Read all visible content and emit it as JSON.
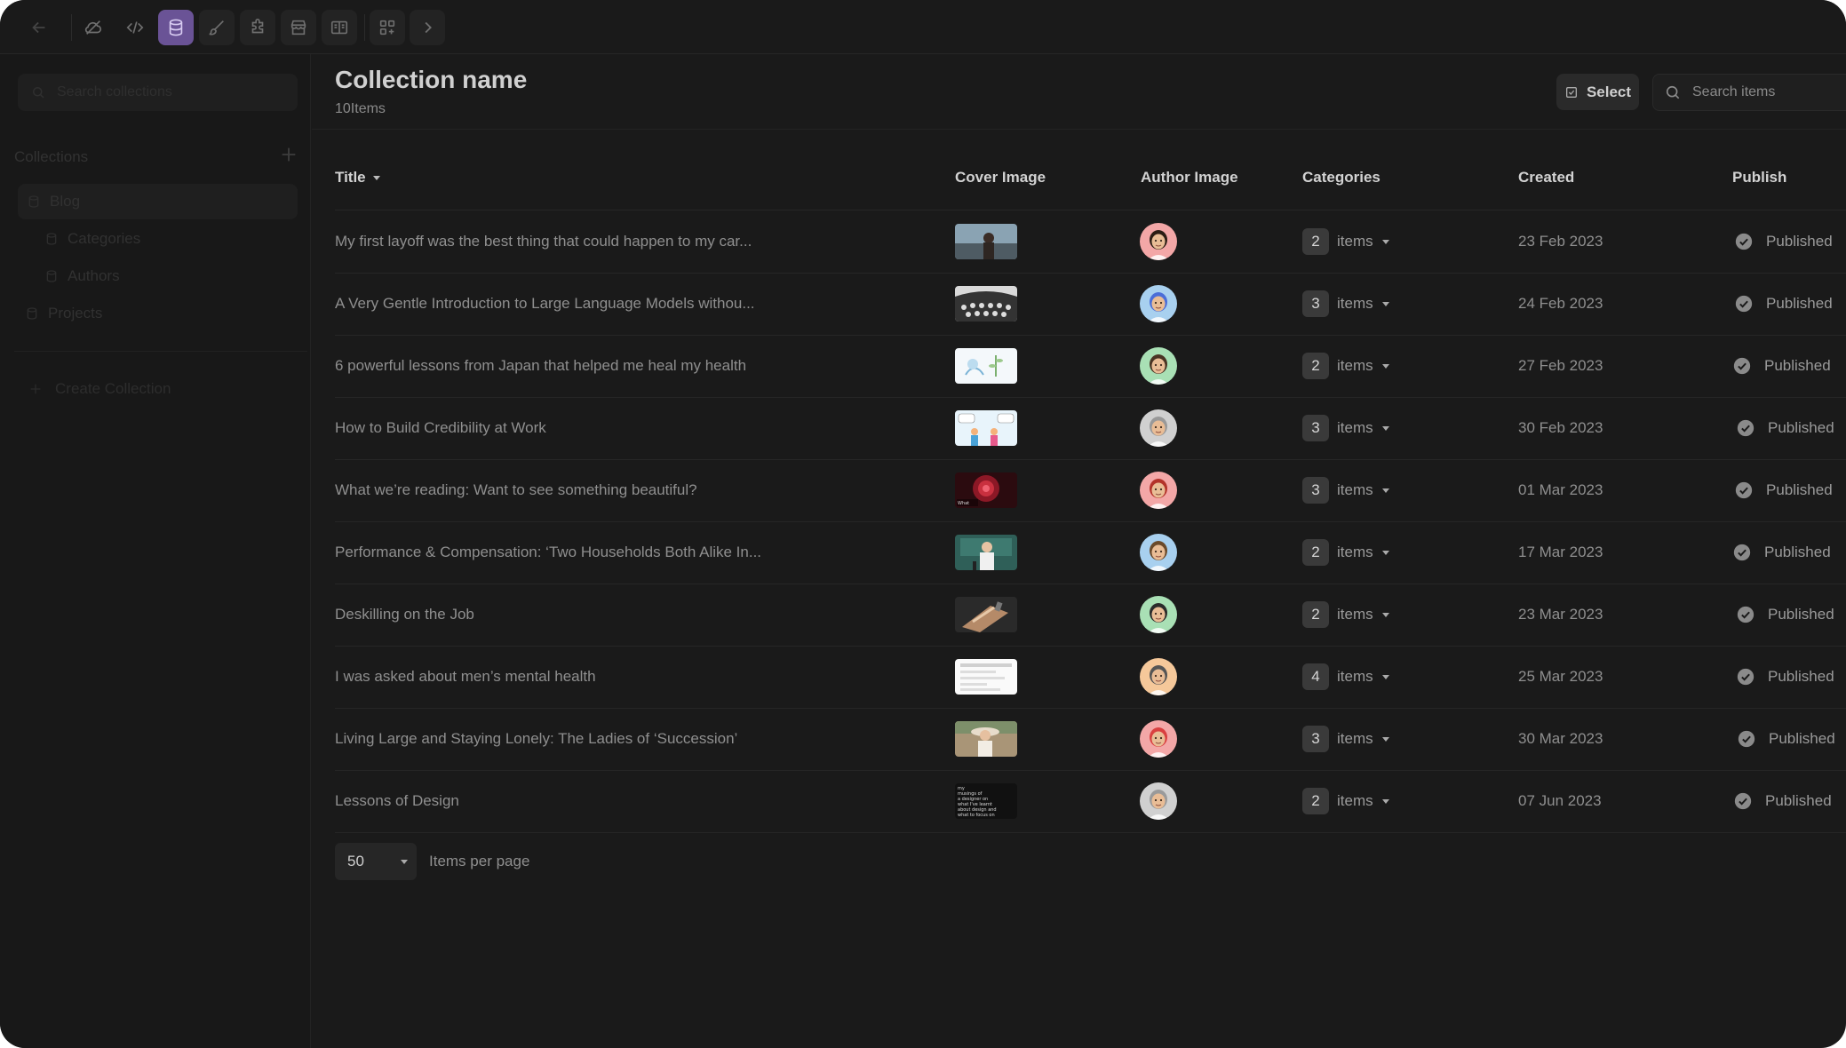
{
  "sidebar": {
    "search_placeholder": "Search collections",
    "heading": "Collections",
    "items": [
      {
        "label": "Blog"
      },
      {
        "label": "Categories"
      },
      {
        "label": "Authors"
      },
      {
        "label": "Projects"
      }
    ],
    "create_label": "Create Collection"
  },
  "header": {
    "title": "Collection name",
    "count": "10Items",
    "select_label": "Select",
    "search_placeholder": "Search items"
  },
  "table": {
    "columns": {
      "title": "Title",
      "cover": "Cover Image",
      "author": "Author Image",
      "categories": "Categories",
      "created": "Created",
      "publish": "Publish"
    },
    "rows": [
      {
        "title": "My first layoff was the best thing that could happen to my car...",
        "cat_count": "2",
        "cat_label": "items",
        "created": "23 Feb 2023",
        "status": "Published"
      },
      {
        "title": "A Very Gentle Introduction to Large Language Models withou...",
        "cat_count": "3",
        "cat_label": "items",
        "created": "24 Feb 2023",
        "status": "Published"
      },
      {
        "title": "6 powerful lessons from Japan that helped me heal my health",
        "cat_count": "2",
        "cat_label": "items",
        "created": "27 Feb 2023",
        "status": "Published"
      },
      {
        "title": "How to Build Credibility at Work",
        "cat_count": "3",
        "cat_label": "items",
        "created": "30 Feb 2023",
        "status": "Published"
      },
      {
        "title": "What we’re reading: Want to see something beautiful?",
        "cat_count": "3",
        "cat_label": "items",
        "created": "01 Mar 2023",
        "status": "Published"
      },
      {
        "title": "Performance & Compensation: ‘Two Households Both Alike In...",
        "cat_count": "2",
        "cat_label": "items",
        "created": "17 Mar 2023",
        "status": "Published"
      },
      {
        "title": "Deskilling on the Job",
        "cat_count": "2",
        "cat_label": "items",
        "created": "23 Mar 2023",
        "status": "Published"
      },
      {
        "title": "I was asked about men’s mental health",
        "cat_count": "4",
        "cat_label": "items",
        "created": "25 Mar 2023",
        "status": "Published"
      },
      {
        "title": "Living Large and Staying Lonely: The Ladies of ‘Succession’",
        "cat_count": "3",
        "cat_label": "items",
        "created": "30 Mar 2023",
        "status": "Published"
      },
      {
        "title": "Lessons of Design",
        "cat_count": "2",
        "cat_label": "items",
        "created": "07 Jun 2023",
        "status": "Published"
      }
    ]
  },
  "pagination": {
    "per_page_value": "50",
    "per_page_label": "Items per page"
  },
  "colors": {
    "background": "#1a1a1a",
    "active_tool": "#6a5396",
    "text_primary": "#d0d0d0",
    "text_muted": "#8f8f8f"
  },
  "icons": {
    "toolbar": [
      "back-arrow-icon",
      "cloud-icon",
      "code-icon",
      "database-icon",
      "brush-icon",
      "puzzle-icon",
      "store-icon",
      "book-icon",
      "apps-add-icon",
      "chevron-right-icon"
    ],
    "status": "check-circle-icon"
  }
}
